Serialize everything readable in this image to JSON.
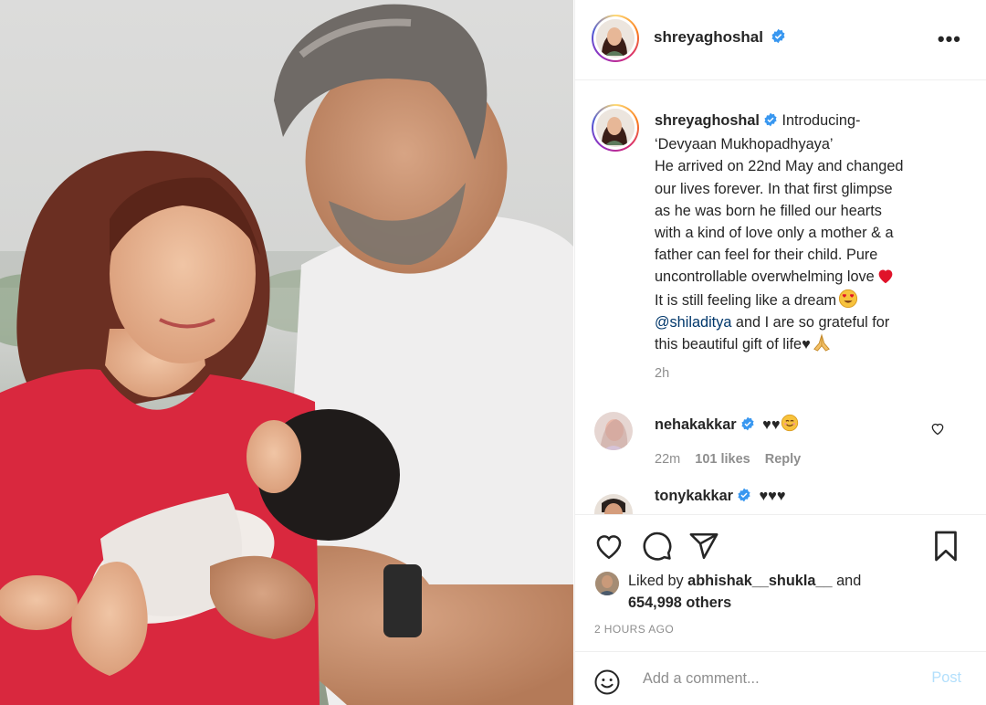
{
  "photo": {
    "alt_icon": "post-photo"
  },
  "post": {
    "author": "shreyaghoshal",
    "author_verified": true,
    "more_icon": "more-options-icon",
    "more_label": "•••"
  },
  "caption": {
    "author": "shreyaghoshal",
    "lines": {
      "l1": "Introducing-",
      "l2": "‘Devyaan Mukhopadhyaya’",
      "l3": "He arrived on 22nd May and changed",
      "l4": "our lives forever. In that first glimpse",
      "l5": "as he was born he filled our hearts",
      "l6": "with a kind of love only a mother & a",
      "l7": "father can feel for their child. Pure",
      "l8": "uncontrollable overwhelming love",
      "l9": "It is still feeling like a dream",
      "mention": "@shiladitya",
      "l10": " and I are so grateful for",
      "l11": "this beautiful gift of life",
      "heart_small": "♥"
    },
    "time": "2h"
  },
  "comments": [
    {
      "author": "nehakakkar",
      "verified": true,
      "text": "♥♥",
      "time": "22m",
      "likes": "101 likes",
      "reply": "Reply"
    },
    {
      "author": "tonykakkar",
      "verified": true,
      "text": "♥♥♥"
    }
  ],
  "actions": {
    "like_icon": "heart-icon",
    "comment_icon": "comment-icon",
    "share_icon": "share-icon",
    "save_icon": "bookmark-icon"
  },
  "likes": {
    "prefix": "Liked by ",
    "user": "abhishak__shukla__",
    "middle": " and",
    "others": "654,998 others"
  },
  "timestamp": "2 HOURS AGO",
  "add_comment": {
    "placeholder": "Add a comment...",
    "post_label": "Post",
    "emoji_icon": "smiley-icon"
  },
  "colors": {
    "verified": "#3897f0",
    "mention": "#00376b",
    "muted": "#8e8e8e",
    "post_disabled": "#b2dffc",
    "dress": "#d9283e"
  }
}
